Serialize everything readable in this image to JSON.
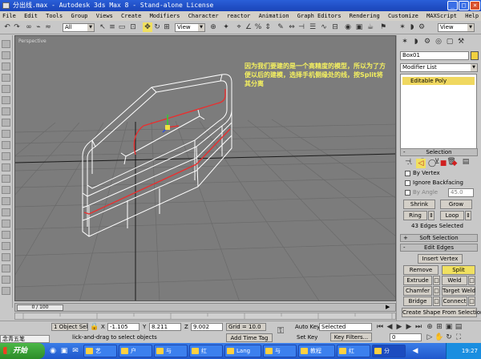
{
  "window": {
    "title": "分出线.max - Autodesk 3ds Max 8 - Stand-alone License",
    "min_label": "_",
    "max_label": "□",
    "close_label": "×"
  },
  "menu": [
    "File",
    "Edit",
    "Tools",
    "Group",
    "Views",
    "Create",
    "Modifiers",
    "Character",
    "reactor",
    "Animation",
    "Graph Editors",
    "Rendering",
    "Customize",
    "MAXScript",
    "Help"
  ],
  "toolbar": {
    "selection_filter": "All",
    "ref_coord": "View",
    "named_sel": "View"
  },
  "viewport": {
    "label": "Perspective",
    "annotation": "因为我们要建的是一个高精度的模型，所以为了方便以后的建模，选择手机侧缘处的线，按Split将其分离"
  },
  "command_panel": {
    "object_name": "Box01",
    "object_color": "#f0d040",
    "modifier_list": "Modifier List",
    "stack_item": "Editable Poly",
    "selection": {
      "title": "Selection",
      "by_vertex": "By Vertex",
      "ignore_backfacing": "Ignore Backfacing",
      "by_angle": "By Angle",
      "angle_value": "45.0",
      "shrink": "Shrink",
      "grow": "Grow",
      "ring": "Ring",
      "loop": "Loop",
      "status": "43 Edges Selected"
    },
    "soft_selection": {
      "title": "Soft Selection"
    },
    "edit_edges": {
      "title": "Edit Edges",
      "insert_vertex": "Insert Vertex",
      "remove": "Remove",
      "split": "Split",
      "extrude": "Extrude",
      "weld": "Weld",
      "chamfer": "Chamfer",
      "target_weld": "Target Weld",
      "bridge": "Bridge",
      "connect": "Connect",
      "create_shape": "Create Shape From Selection"
    }
  },
  "timeline": {
    "frame_label": "0 / 100",
    "frame_progress": 0.0
  },
  "status": {
    "selected": "1 Object Sele",
    "x_label": "X",
    "x_value": "-1.105",
    "y_label": "Y",
    "y_value": "8.211",
    "z_label": "Z",
    "z_value": "9.002",
    "grid": "Grid = 10.0",
    "autokey": "Auto Key",
    "autokey_mode": "Selected",
    "setkey": "Set Key",
    "key_filters": "Key Filters...",
    "frame_field": "0",
    "prompt": "lick-and-drag to select objects",
    "add_time_tag": "Add Time Tag"
  },
  "ime": "念青五笔",
  "taskbar": {
    "start": "开始",
    "items": [
      "艺",
      "户",
      "与",
      "红",
      "Lang",
      "与",
      "教程",
      "红",
      "分"
    ],
    "clock": "19:27"
  }
}
